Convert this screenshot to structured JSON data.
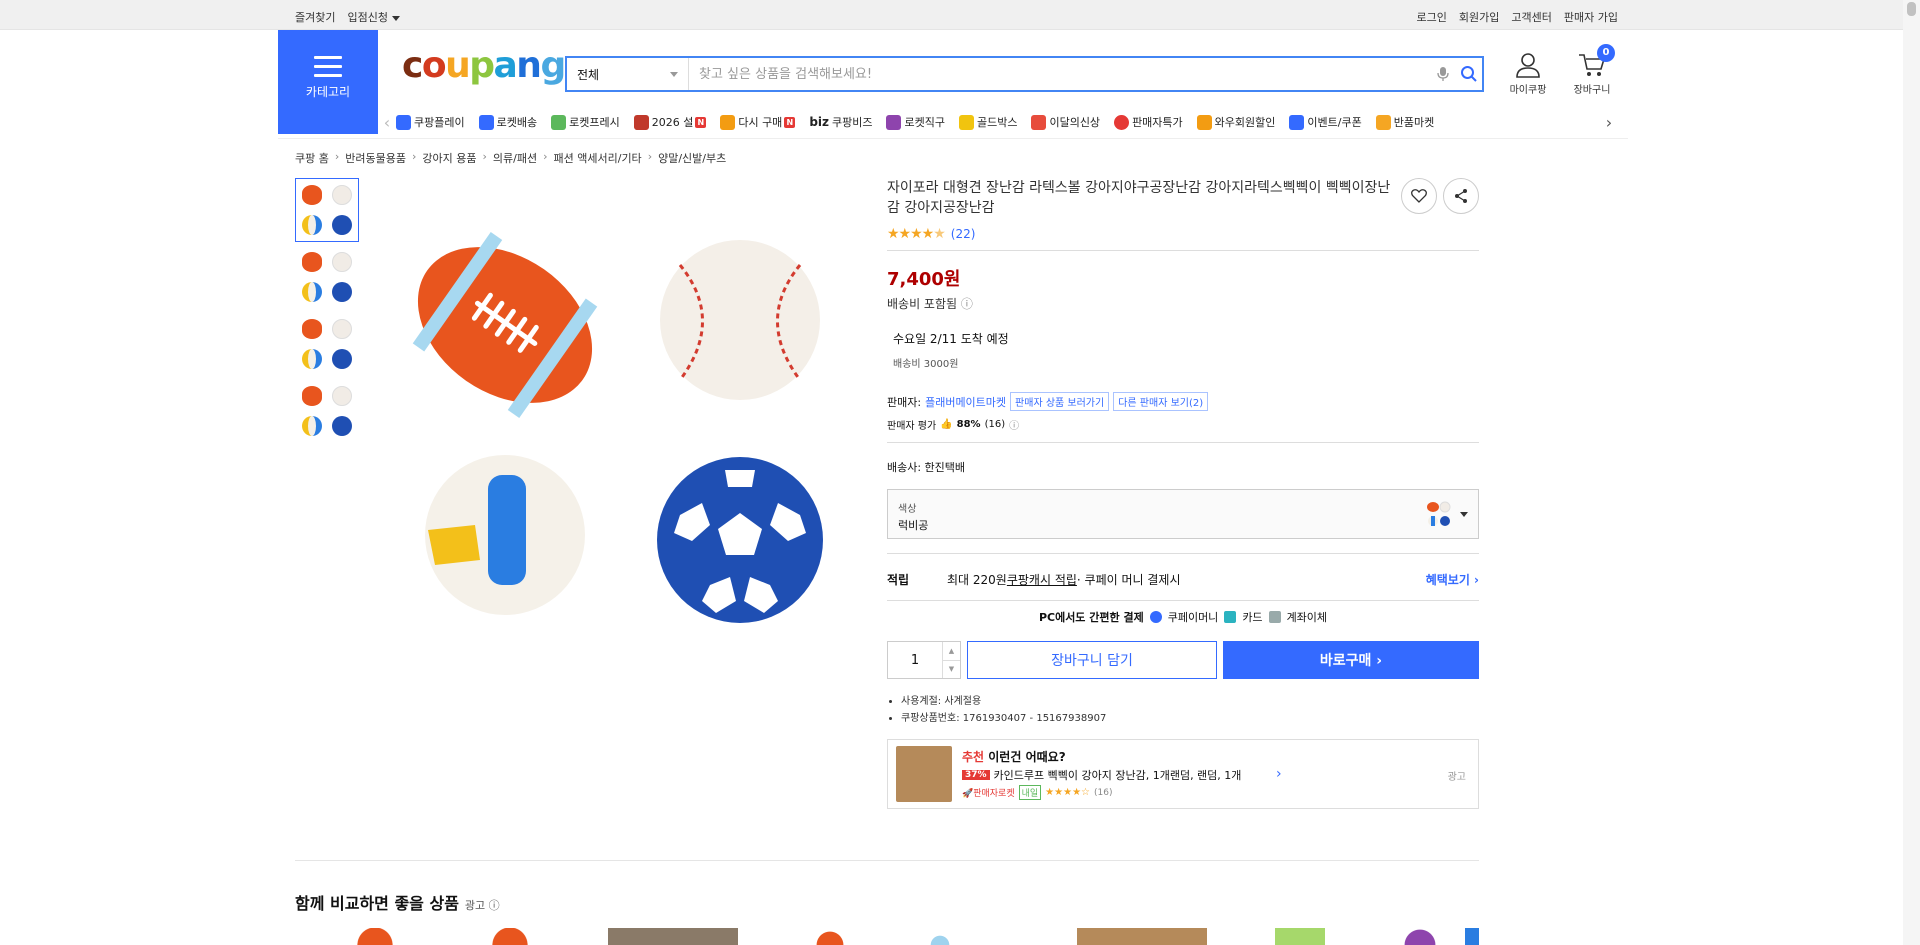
{
  "topbar": {
    "left": [
      "즐겨찾기",
      "입점신청"
    ],
    "right": [
      "로그인",
      "회원가입",
      "고객센터",
      "판매자 가입"
    ]
  },
  "header": {
    "category_label": "카테고리",
    "logo": "coupang",
    "search_scope": "전체",
    "search_placeholder": "찾고 싶은 상품을 검색해보세요!",
    "my_label": "마이쿠팡",
    "cart_label": "장바구니",
    "cart_count": "0"
  },
  "nav": [
    {
      "label": "쿠팡플레이",
      "color": "#346aff"
    },
    {
      "label": "로켓배송",
      "color": "#346aff"
    },
    {
      "label": "로켓프레시",
      "color": "#5cb85c"
    },
    {
      "label": "2026 설",
      "color": "#c0392b",
      "new": "N"
    },
    {
      "label": "다시 구매",
      "color": "#f39c12",
      "new": "N"
    },
    {
      "label": "쿠팡비즈",
      "color": "#333",
      "prefix": "biz"
    },
    {
      "label": "로켓직구",
      "color": "#8e44ad"
    },
    {
      "label": "골드박스",
      "color": "#f1c40f"
    },
    {
      "label": "이달의신상",
      "color": "#e74c3c"
    },
    {
      "label": "판매자특가",
      "color": "#e53935"
    },
    {
      "label": "와우회원할인",
      "color": "#f39c12"
    },
    {
      "label": "이벤트/쿠폰",
      "color": "#346aff"
    },
    {
      "label": "반품마켓",
      "color": "#f5a623"
    }
  ],
  "breadcrumb": [
    "쿠팡 홈",
    "반려동물용품",
    "강아지 용품",
    "의류/패션",
    "패션 액세서리/기타",
    "양말/신발/부츠"
  ],
  "product": {
    "title": "자이포라 대형견 장난감 라텍스볼 강아지야구공장난감 강아지라텍스삑삑이 삑삑이장난감 강아지공장난감",
    "rating_count": "(22)",
    "rating_stars": 4.5,
    "price": "7,400원",
    "shipping_included": "배송비 포함됨",
    "delivery": "수요일 2/11 도착 예정",
    "fee": "배송비 3000원",
    "seller_label": "판매자:",
    "seller_name": "플래버메이트마켓",
    "seller_products_btn": "판매자 상품 보러가기",
    "other_sellers_btn": "다른 판매자 보기(2)",
    "eval_label": "판매자 평가",
    "eval_value": "88%",
    "eval_count": "(16)",
    "courier": "배송사:  한진택배",
    "color_key": "색상",
    "color_value": "럭비공",
    "reward_label": "적립",
    "reward_text1": "최대 220원 ",
    "reward_link": "쿠팡캐시 적립",
    "reward_text2": " · 쿠페이 머니 결제시",
    "reward_more": "혜택보기 ›",
    "pay_title": "PC에서도 간편한 결제",
    "pay_methods": [
      "쿠페이머니",
      "카드",
      "계좌이체"
    ],
    "quantity": "1",
    "cart_btn": "장바구니 담기",
    "buy_btn": "바로구매 ›",
    "bullets": [
      "사용계절: 사계절용",
      "쿠팡상품번호: 1761930407 - 15167938907"
    ]
  },
  "recommend": {
    "title_red": "추천",
    "title": " 이런건 어때요?",
    "discount": "37%",
    "name": "카인드루프 삑삑이 강아지 장난감, 1개랜덤, 랜덤, 1개",
    "badge": "🚀판매자로켓",
    "badge2": "내일",
    "count": "(16)",
    "ad": "광고"
  },
  "compare": {
    "title": "함께 비교하면 좋을 상품",
    "ad": "광고"
  }
}
